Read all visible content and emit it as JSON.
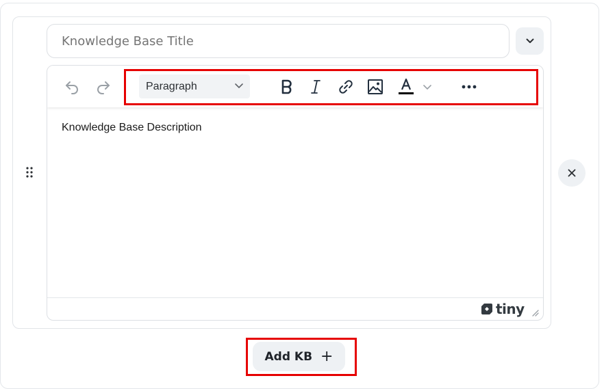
{
  "kb_item": {
    "title_placeholder": "Knowledge Base Title",
    "description": "Knowledge Base Description"
  },
  "editor": {
    "toolbar": {
      "block_format": "Paragraph",
      "buttons": [
        "undo-icon",
        "redo-icon",
        "bold-icon",
        "italic-icon",
        "link-icon",
        "image-icon",
        "text-color-icon",
        "more-icon"
      ]
    },
    "branding": "tiny"
  },
  "actions": {
    "add_kb_label": "Add KB",
    "add_kb_icon": "+"
  },
  "colors": {
    "highlight": "#e60000",
    "button_bg": "#eef1f4",
    "text": "#1f2329"
  }
}
